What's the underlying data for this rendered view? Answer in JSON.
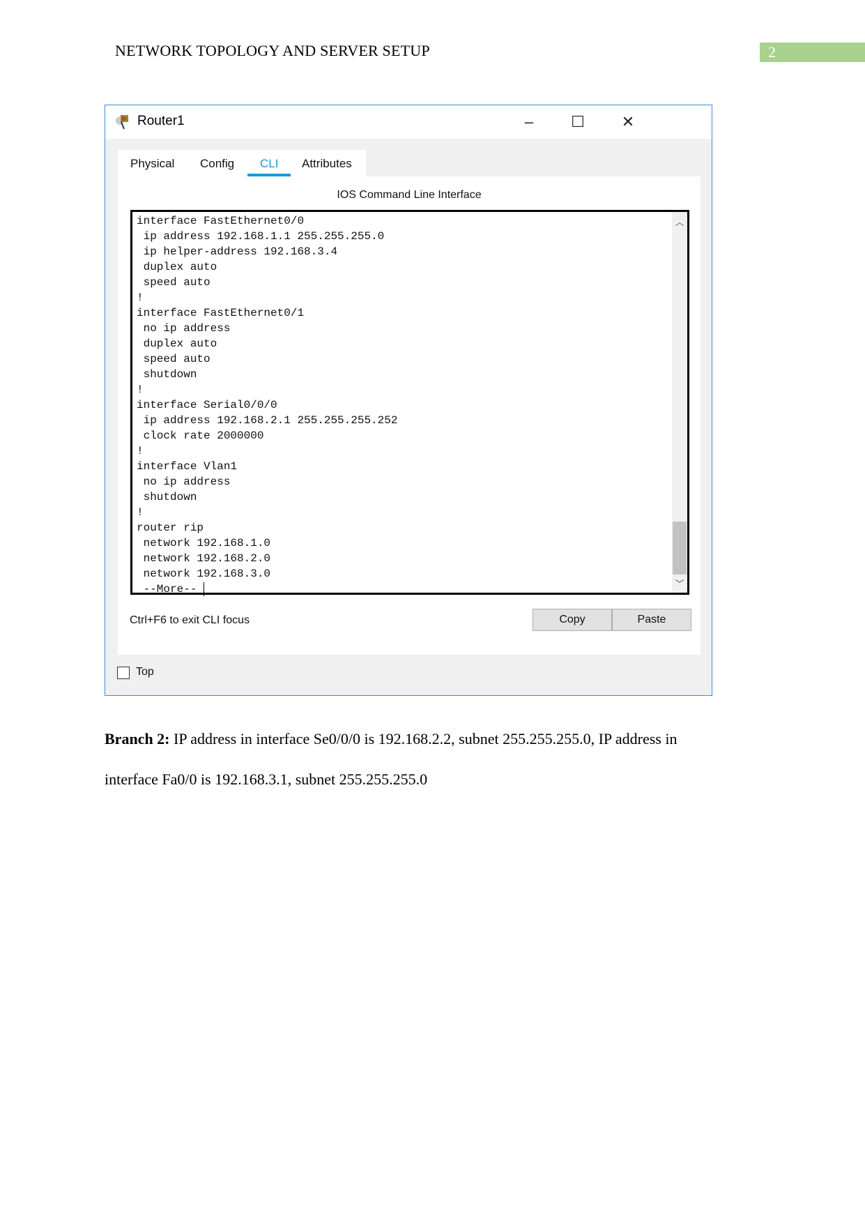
{
  "header": {
    "title": "NETWORK TOPOLOGY AND SERVER SETUP",
    "page_number": "2",
    "page_number_bg": "#a9d18e"
  },
  "window": {
    "title": "Router1",
    "icon": "router-icon",
    "controls": {
      "minimize": "–",
      "maximize": "☐",
      "close": "✕"
    },
    "tabs": [
      {
        "label": "Physical"
      },
      {
        "label": "Config"
      },
      {
        "label": "CLI",
        "active": true
      },
      {
        "label": "Attributes"
      }
    ],
    "accent": "#1a9ad6",
    "cli_title": "IOS Command Line Interface",
    "cli_lines": [
      "interface FastEthernet0/0",
      " ip address 192.168.1.1 255.255.255.0",
      " ip helper-address 192.168.3.4",
      " duplex auto",
      " speed auto",
      "!",
      "interface FastEthernet0/1",
      " no ip address",
      " duplex auto",
      " speed auto",
      " shutdown",
      "!",
      "interface Serial0/0/0",
      " ip address 192.168.2.1 255.255.255.252",
      " clock rate 2000000",
      "!",
      "interface Vlan1",
      " no ip address",
      " shutdown",
      "!",
      "router rip",
      " network 192.168.1.0",
      " network 192.168.2.0",
      " network 192.168.3.0",
      " --More-- "
    ],
    "hint": "Ctrl+F6 to exit CLI focus",
    "copy_label": "Copy",
    "paste_label": "Paste",
    "top_label": "Top",
    "top_checked": false
  },
  "body": {
    "p1_bold": "Branch 2:",
    "p1_text": " IP address in interface Se0/0/0 is 192.168.2.2, subnet 255.255.255.0, IP address in",
    "p2_text": "interface Fa0/0 is 192.168.3.1, subnet 255.255.255.0"
  }
}
